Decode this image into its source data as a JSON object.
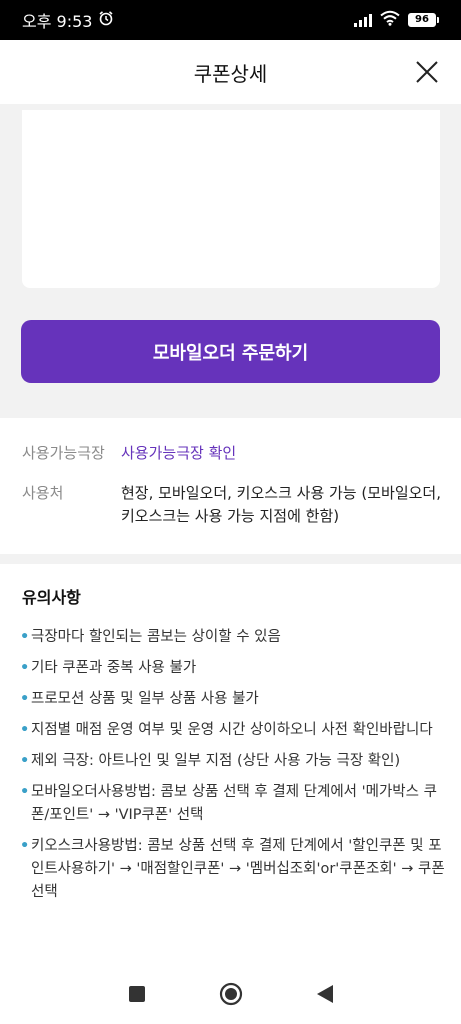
{
  "status_bar": {
    "time": "오후 9:53",
    "battery": "96"
  },
  "header": {
    "title": "쿠폰상세"
  },
  "order_button": {
    "label": "모바일오더 주문하기"
  },
  "info": {
    "theater_label": "사용가능극장",
    "theater_link": "사용가능극장 확인",
    "usage_label": "사용처",
    "usage_value": "현장, 모바일오더, 키오스크 사용 가능 (모바일오더, 키오스크는 사용 가능 지점에 한함)"
  },
  "notes": {
    "title": "유의사항",
    "bullet": "•",
    "items": [
      "극장마다 할인되는 콤보는 상이할 수 있음",
      "기타 쿠폰과 중복 사용 불가",
      "프로모션 상품 및 일부 상품 사용 불가",
      "지점별 매점 운영 여부 및 운영 시간 상이하오니 사전 확인바랍니다",
      "제외 극장: 아트나인 및 일부 지점 (상단 사용 가능 극장 확인)",
      "모바일오더사용방법: 콤보 상품 선택 후 결제 단계에서 '메가박스 쿠폰/포인트' → 'VIP쿠폰' 선택",
      "키오스크사용방법: 콤보 상품 선택 후 결제 단계에서 '할인쿠폰 및 포인트사용하기' → '매점할인쿠폰' → '멤버십조회'or'쿠폰조회' → 쿠폰 선택"
    ]
  },
  "colors": {
    "accent": "#6633bb",
    "bullet": "#3aa0c8",
    "background_gray": "#f2f2f2"
  },
  "icons": [
    "alarm-icon",
    "signal-icon",
    "wifi-icon",
    "battery-icon",
    "close-icon",
    "recents-icon",
    "home-icon",
    "back-icon"
  ]
}
